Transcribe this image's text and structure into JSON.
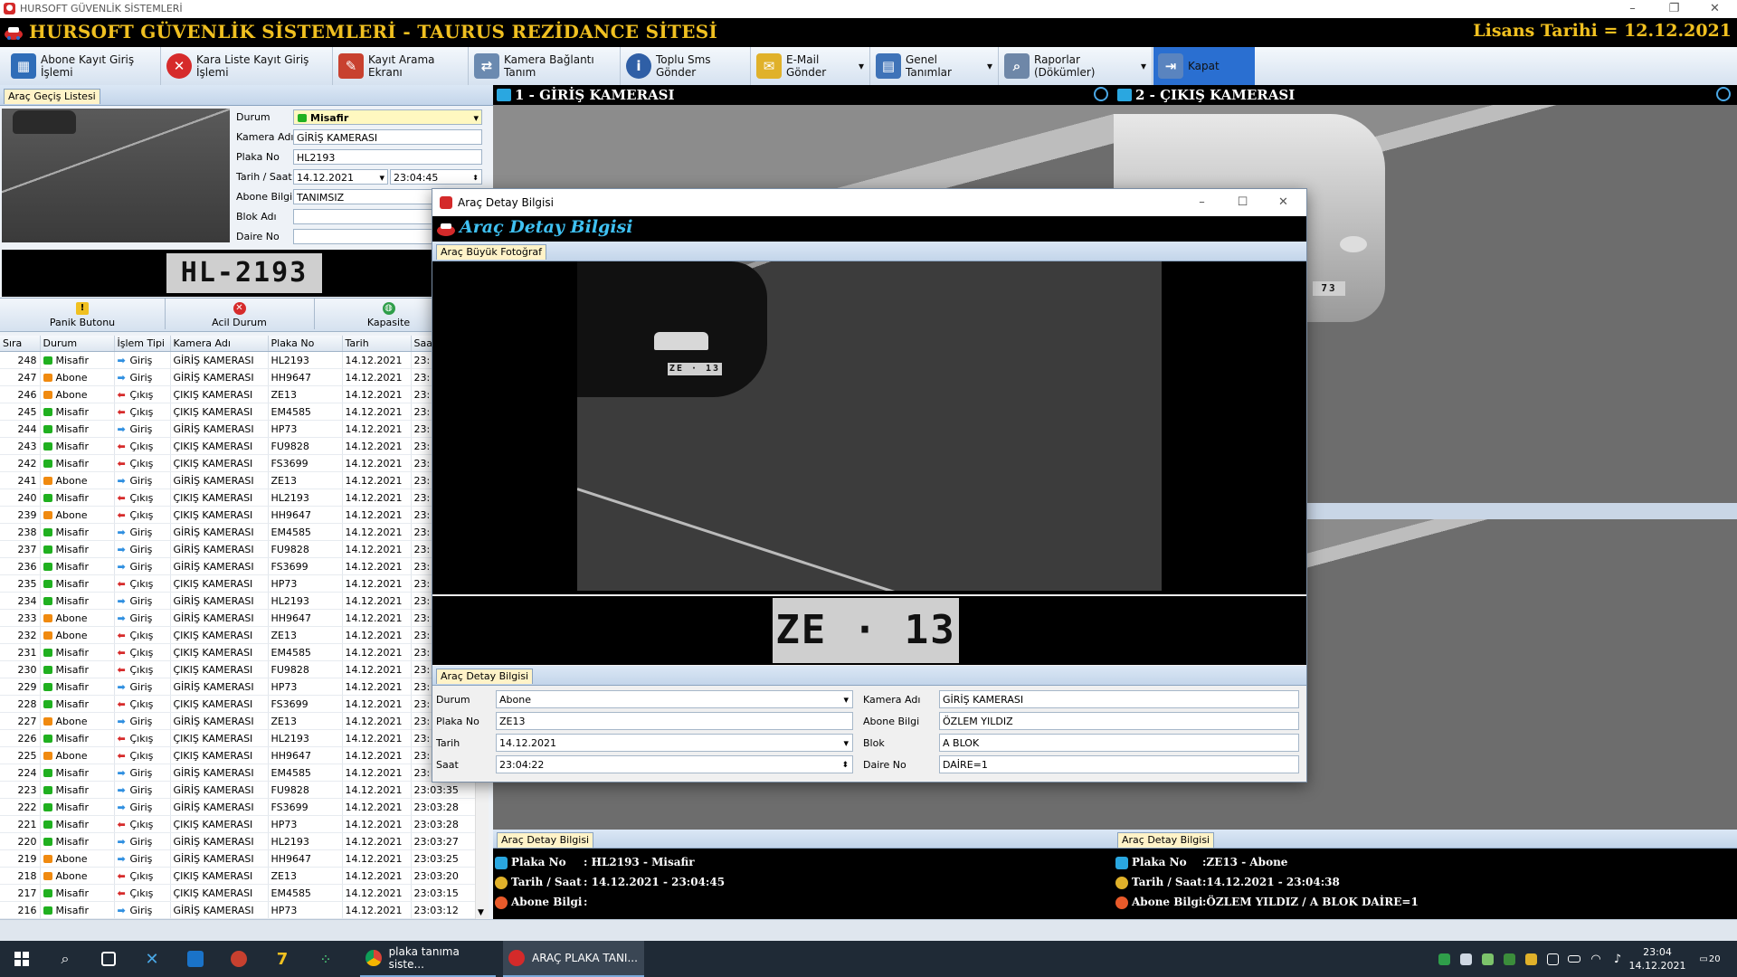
{
  "window": {
    "title": "HURSOFT GÜVENLİK SİSTEMLERİ",
    "min": "–",
    "max": "❐",
    "close": "✕"
  },
  "header": {
    "app_title": "HURSOFT GÜVENLİK SİSTEMLERİ - TAURUS REZİDANCE SİTESİ",
    "license": "Lisans Tarihi = 12.12.2021"
  },
  "toolbar": [
    {
      "label": "Abone Kayıt Giriş İşlemi",
      "icon": "grid-icon",
      "color": "#2f6db8"
    },
    {
      "label": "Kara Liste Kayıt Giriş İşlemi",
      "icon": "x-circle-icon",
      "color": "#d62b2b"
    },
    {
      "label": "Kayıt Arama Ekranı",
      "icon": "search-pen-icon",
      "color": "#c8412f"
    },
    {
      "label": "Kamera Bağlantı Tanım",
      "icon": "camera-link-icon",
      "color": "#6b8ab0"
    },
    {
      "label": "Toplu Sms Gönder",
      "icon": "info-icon",
      "color": "#2f5fa6"
    },
    {
      "label": "E-Mail Gönder",
      "icon": "mail-ruler-icon",
      "color": "#e0b12a"
    },
    {
      "label": "Genel Tanımlar",
      "icon": "calendar-icon",
      "color": "#3f73b8"
    },
    {
      "label": "Raporlar (Dökümler)",
      "icon": "report-search-icon",
      "color": "#6e87a8"
    },
    {
      "label": "Kapat",
      "icon": "exit-icon",
      "color": "#5a84bf"
    }
  ],
  "left": {
    "tab": "Araç Geçiş Listesi",
    "fields": [
      {
        "label": "Durum",
        "value": "Misafir"
      },
      {
        "label": "Kamera Adı",
        "value": "GİRİŞ KAMERASI"
      },
      {
        "label": "Plaka No",
        "value": "HL2193"
      },
      {
        "label": "Tarih / Saat",
        "value": "14.12.2021",
        "time": "23:04:45"
      },
      {
        "label": "Abone Bilgi",
        "value": "TANIMSIZ"
      },
      {
        "label": "Blok Adı",
        "value": ""
      },
      {
        "label": "Daire No",
        "value": ""
      }
    ],
    "plate": "HL-2193",
    "buttons": [
      {
        "label": "Panik Butonu",
        "icon": "warning-icon",
        "color": "#f0c020"
      },
      {
        "label": "Acil Durum",
        "icon": "x-circle-icon",
        "color": "#d62b2b"
      },
      {
        "label": "Kapasite",
        "icon": "globe-icon",
        "color": "#2f9e4a"
      }
    ]
  },
  "table": {
    "columns": [
      "Sıra",
      "Durum",
      "İşlem Tipi",
      "Kamera Adı",
      "Plaka No",
      "Tarih",
      "Saat"
    ],
    "rows": [
      [
        "248",
        "Misafir",
        "Giriş",
        "GİRİŞ KAMERASI",
        "HL2193",
        "14.12.2021",
        "23:"
      ],
      [
        "247",
        "Abone",
        "Giriş",
        "GİRİŞ KAMERASI",
        "HH9647",
        "14.12.2021",
        "23:"
      ],
      [
        "246",
        "Abone",
        "Çıkış",
        "ÇIKIŞ KAMERASI",
        "ZE13",
        "14.12.2021",
        "23:"
      ],
      [
        "245",
        "Misafir",
        "Çıkış",
        "ÇIKIŞ KAMERASI",
        "EM4585",
        "14.12.2021",
        "23:"
      ],
      [
        "244",
        "Misafir",
        "Giriş",
        "GİRİŞ KAMERASI",
        "HP73",
        "14.12.2021",
        "23:"
      ],
      [
        "243",
        "Misafir",
        "Çıkış",
        "ÇIKIŞ KAMERASI",
        "FU9828",
        "14.12.2021",
        "23:"
      ],
      [
        "242",
        "Misafir",
        "Çıkış",
        "ÇIKIŞ KAMERASI",
        "FS3699",
        "14.12.2021",
        "23:"
      ],
      [
        "241",
        "Abone",
        "Giriş",
        "GİRİŞ KAMERASI",
        "ZE13",
        "14.12.2021",
        "23:"
      ],
      [
        "240",
        "Misafir",
        "Çıkış",
        "ÇIKIŞ KAMERASI",
        "HL2193",
        "14.12.2021",
        "23:"
      ],
      [
        "239",
        "Abone",
        "Çıkış",
        "ÇIKIŞ KAMERASI",
        "HH9647",
        "14.12.2021",
        "23:"
      ],
      [
        "238",
        "Misafir",
        "Giriş",
        "GİRİŞ KAMERASI",
        "EM4585",
        "14.12.2021",
        "23:"
      ],
      [
        "237",
        "Misafir",
        "Giriş",
        "GİRİŞ KAMERASI",
        "FU9828",
        "14.12.2021",
        "23:"
      ],
      [
        "236",
        "Misafir",
        "Giriş",
        "GİRİŞ KAMERASI",
        "FS3699",
        "14.12.2021",
        "23:"
      ],
      [
        "235",
        "Misafir",
        "Çıkış",
        "ÇIKIŞ KAMERASI",
        "HP73",
        "14.12.2021",
        "23:"
      ],
      [
        "234",
        "Misafir",
        "Giriş",
        "GİRİŞ KAMERASI",
        "HL2193",
        "14.12.2021",
        "23:"
      ],
      [
        "233",
        "Abone",
        "Giriş",
        "GİRİŞ KAMERASI",
        "HH9647",
        "14.12.2021",
        "23:"
      ],
      [
        "232",
        "Abone",
        "Çıkış",
        "ÇIKIŞ KAMERASI",
        "ZE13",
        "14.12.2021",
        "23:"
      ],
      [
        "231",
        "Misafir",
        "Çıkış",
        "ÇIKIŞ KAMERASI",
        "EM4585",
        "14.12.2021",
        "23:"
      ],
      [
        "230",
        "Misafir",
        "Çıkış",
        "ÇIKIŞ KAMERASI",
        "FU9828",
        "14.12.2021",
        "23:"
      ],
      [
        "229",
        "Misafir",
        "Giriş",
        "GİRİŞ KAMERASI",
        "HP73",
        "14.12.2021",
        "23:"
      ],
      [
        "228",
        "Misafir",
        "Çıkış",
        "ÇIKIŞ KAMERASI",
        "FS3699",
        "14.12.2021",
        "23:"
      ],
      [
        "227",
        "Abone",
        "Giriş",
        "GİRİŞ KAMERASI",
        "ZE13",
        "14.12.2021",
        "23:"
      ],
      [
        "226",
        "Misafir",
        "Çıkış",
        "ÇIKIŞ KAMERASI",
        "HL2193",
        "14.12.2021",
        "23:"
      ],
      [
        "225",
        "Abone",
        "Çıkış",
        "ÇIKIŞ KAMERASI",
        "HH9647",
        "14.12.2021",
        "23:"
      ],
      [
        "224",
        "Misafir",
        "Giriş",
        "GİRİŞ KAMERASI",
        "EM4585",
        "14.12.2021",
        "23:"
      ],
      [
        "223",
        "Misafir",
        "Giriş",
        "GİRİŞ KAMERASI",
        "FU9828",
        "14.12.2021",
        "23:03:35"
      ],
      [
        "222",
        "Misafir",
        "Giriş",
        "GİRİŞ KAMERASI",
        "FS3699",
        "14.12.2021",
        "23:03:28"
      ],
      [
        "221",
        "Misafir",
        "Çıkış",
        "ÇIKIŞ KAMERASI",
        "HP73",
        "14.12.2021",
        "23:03:28"
      ],
      [
        "220",
        "Misafir",
        "Giriş",
        "GİRİŞ KAMERASI",
        "HL2193",
        "14.12.2021",
        "23:03:27"
      ],
      [
        "219",
        "Abone",
        "Giriş",
        "GİRİŞ KAMERASI",
        "HH9647",
        "14.12.2021",
        "23:03:25"
      ],
      [
        "218",
        "Abone",
        "Çıkış",
        "ÇIKIŞ KAMERASI",
        "ZE13",
        "14.12.2021",
        "23:03:20"
      ],
      [
        "217",
        "Misafir",
        "Çıkış",
        "ÇIKIŞ KAMERASI",
        "EM4585",
        "14.12.2021",
        "23:03:15"
      ],
      [
        "216",
        "Misafir",
        "Giriş",
        "GİRİŞ KAMERASI",
        "HP73",
        "14.12.2021",
        "23:03:12"
      ]
    ],
    "status_colors": {
      "Misafir": "#20b020",
      "Abone": "#f08a10"
    }
  },
  "cameras": [
    {
      "title": "1 - GİRİŞ KAMERASI",
      "tab": "Araç Detay Bilgisi",
      "info": [
        {
          "label": "Plaka No",
          "value": ": HL2193 - Misafir"
        },
        {
          "label": "Tarih / Saat",
          "value": ": 14.12.2021 - 23:04:45"
        },
        {
          "label": "Abone Bilgi",
          "value": ":"
        }
      ]
    },
    {
      "title": "2 - ÇIKIŞ KAMERASI",
      "tab": "Araç Detay Bilgisi",
      "plate_fragment": "73",
      "info": [
        {
          "label": "Plaka No",
          "value": ":ZE13 - Abone"
        },
        {
          "label": "Tarih / Saat",
          "value": ":14.12.2021 - 23:04:38"
        },
        {
          "label": "Abone Bilgi",
          "value": ":ÖZLEM YILDIZ / A BLOK DAİRE=1"
        }
      ]
    }
  ],
  "dialog": {
    "title": "Araç Detay Bilgisi",
    "banner": "Araç Detay Bilgisi",
    "photo_tab": "Araç Büyük Fotoğraf",
    "car_plate": "ZE · 13",
    "plate_crop": "ZE · 13",
    "detail_tab": "Araç Detay Bilgisi",
    "left_fields": [
      {
        "label": "Durum",
        "value": "Abone",
        "control": "dropdown"
      },
      {
        "label": "Plaka No",
        "value": "ZE13",
        "control": "text"
      },
      {
        "label": "Tarih",
        "value": "14.12.2021",
        "control": "dropdown"
      },
      {
        "label": "Saat",
        "value": "23:04:22",
        "control": "spin"
      }
    ],
    "right_fields": [
      {
        "label": "Kamera Adı",
        "value": "GİRİŞ KAMERASI"
      },
      {
        "label": "Abone Bilgi",
        "value": "ÖZLEM YILDIZ"
      },
      {
        "label": "Blok",
        "value": "A BLOK"
      },
      {
        "label": "Daire No",
        "value": "DAİRE=1"
      }
    ]
  },
  "taskbar": {
    "items": [
      {
        "label": "plaka tanıma siste...",
        "icon": "chrome-icon"
      },
      {
        "label": "ARAÇ PLAKA TANI...",
        "icon": "app-icon"
      }
    ],
    "time": "23:04",
    "date": "14.12.2021",
    "notif": "20"
  }
}
